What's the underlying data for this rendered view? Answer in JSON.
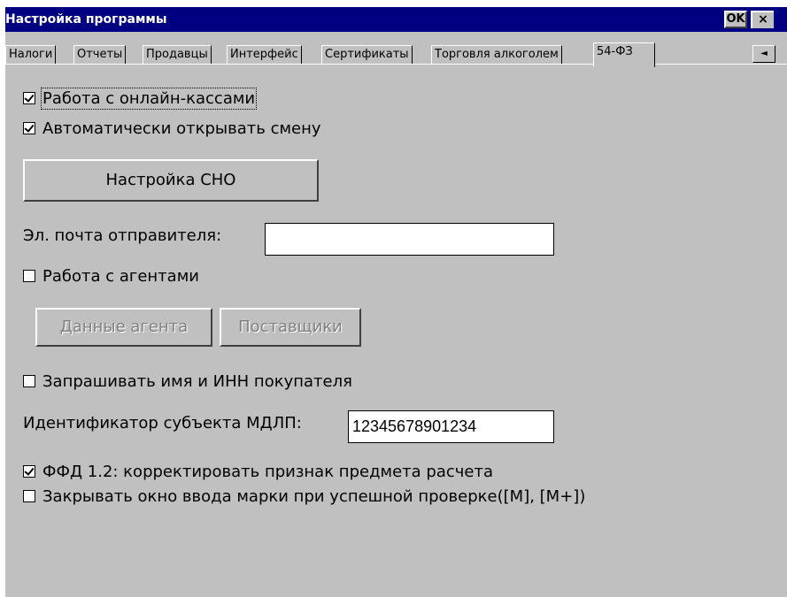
{
  "window": {
    "title": "Настройка программы",
    "ok_label": "OK",
    "close_label": "×"
  },
  "tabs": [
    {
      "label": "Налоги",
      "active": false
    },
    {
      "label": "Отчеты",
      "active": false
    },
    {
      "label": "Продавцы",
      "active": false
    },
    {
      "label": "Интерфейс",
      "active": false
    },
    {
      "label": "Сертификаты",
      "active": false
    },
    {
      "label": "Торговля алкоголем",
      "active": false
    },
    {
      "label": "54-ФЗ",
      "active": true
    }
  ],
  "tab_scroll_icon": "◄",
  "settings": {
    "online_kkt_label": "Работа с онлайн-кассами",
    "online_kkt_checked": true,
    "auto_open_shift_label": "Автоматически открывать смену",
    "auto_open_shift_checked": true,
    "sno_button_label": "Настройка СНО",
    "sender_email_label": "Эл. почта отправителя:",
    "sender_email_value": "",
    "agents_label": "Работа с агентами",
    "agents_checked": false,
    "agent_data_button_label": "Данные агента",
    "suppliers_button_label": "Поставщики",
    "ask_buyer_label": "Запрашивать имя и ИНН покупателя",
    "ask_buyer_checked": false,
    "mdlp_id_label": "Идентификатор субъекта МДЛП:",
    "mdlp_id_value": "12345678901234",
    "ffd12_label": "ФФД 1.2: корректировать признак предмета расчета",
    "ffd12_checked": true,
    "close_mark_window_label": "Закрывать окно ввода марки при успешной проверке([M], [M+])",
    "close_mark_window_checked": false
  }
}
